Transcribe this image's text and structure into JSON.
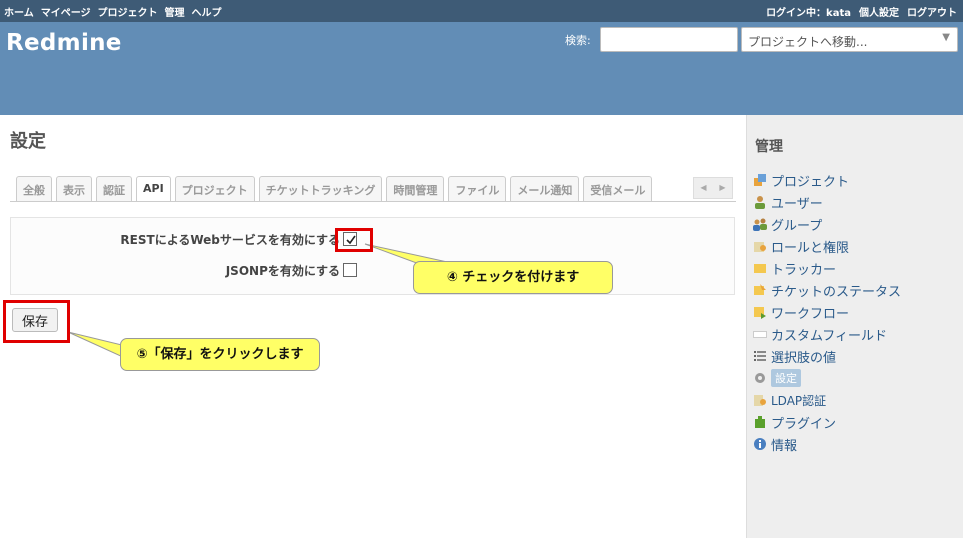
{
  "top_menu": {
    "items": [
      "ホーム",
      "マイページ",
      "プロジェクト",
      "管理",
      "ヘルプ"
    ],
    "logged_in": "ログイン中：kata",
    "personal_settings": "個人設定",
    "logout": "ログアウト"
  },
  "header": {
    "title": "Redmine",
    "search_label": "検索:",
    "search_value": "",
    "project_jump": "プロジェクトへ移動...",
    "project_jump_caret": "▼"
  },
  "page": {
    "title": "設定"
  },
  "tabs": [
    {
      "label": "全般",
      "selected": false
    },
    {
      "label": "表示",
      "selected": false
    },
    {
      "label": "認証",
      "selected": false
    },
    {
      "label": "API",
      "selected": true
    },
    {
      "label": "プロジェクト",
      "selected": false
    },
    {
      "label": "チケットトラッキング",
      "selected": false
    },
    {
      "label": "時間管理",
      "selected": false
    },
    {
      "label": "ファイル",
      "selected": false
    },
    {
      "label": "メール通知",
      "selected": false
    },
    {
      "label": "受信メール",
      "selected": false
    }
  ],
  "tab_nav": {
    "prev": "◀",
    "next": "▶"
  },
  "settings": {
    "rest_label": "RESTによるWebサービスを有効にする",
    "rest_checked": true,
    "jsonp_label": "JSONPを有効にする",
    "jsonp_checked": false
  },
  "save_button": "保存",
  "annotations": {
    "step4": "④ チェックを付けます",
    "step5": "⑤「保存」をクリックします",
    "highlight_color": "#e00000",
    "callout_color": "#ffff66"
  },
  "sidebar": {
    "title": "管理",
    "items": [
      {
        "label": "プロジェクト",
        "icon": "projects-icon"
      },
      {
        "label": "ユーザー",
        "icon": "user-icon"
      },
      {
        "label": "グループ",
        "icon": "group-icon"
      },
      {
        "label": "ロールと権限",
        "icon": "role-icon"
      },
      {
        "label": "トラッカー",
        "icon": "tracker-icon"
      },
      {
        "label": "チケットのステータス",
        "icon": "issue-status-icon"
      },
      {
        "label": "ワークフロー",
        "icon": "workflow-icon"
      },
      {
        "label": "カスタムフィールド",
        "icon": "custom-field-icon"
      },
      {
        "label": "選択肢の値",
        "icon": "list-icon"
      },
      {
        "label": "設定",
        "icon": "settings-gear-icon",
        "selected": true
      },
      {
        "label": "LDAP認証",
        "icon": "ldap-icon"
      },
      {
        "label": "プラグイン",
        "icon": "plugin-icon"
      },
      {
        "label": "情報",
        "icon": "info-icon"
      }
    ]
  },
  "colors": {
    "top_menu_bg": "#3e5b76",
    "header_bg": "#628db6",
    "sidebar_bg": "#eeeeee",
    "link": "#2a5a8a"
  }
}
